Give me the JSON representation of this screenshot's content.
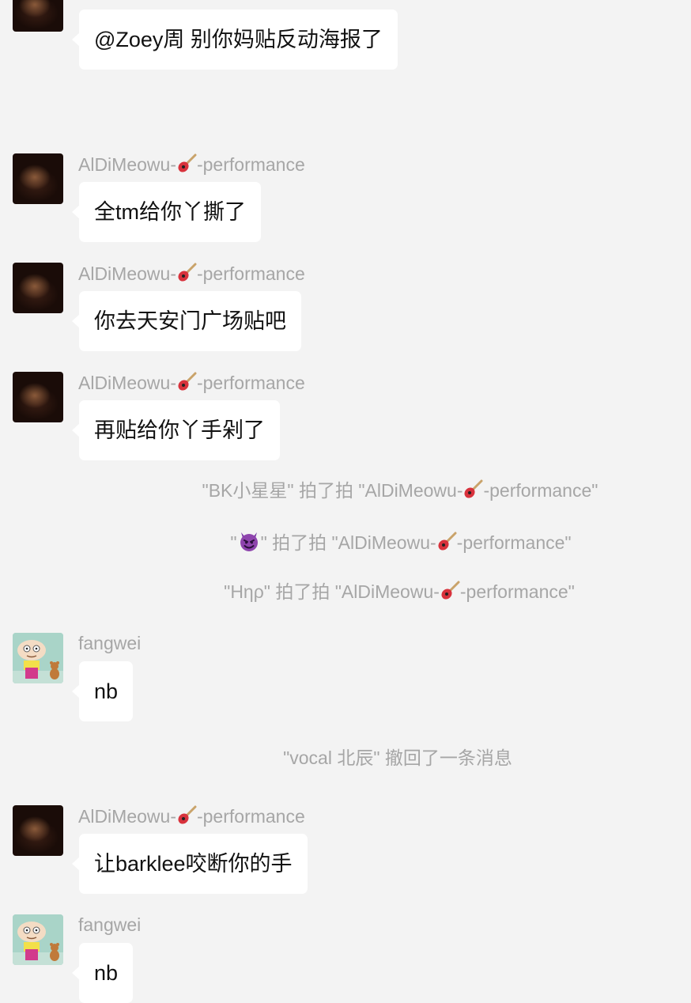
{
  "messages": [
    {
      "sender": "",
      "text": "@Zoey周 别你妈贴反动海报了"
    },
    {
      "sender_prefix": "AlDiMeowu-",
      "sender_suffix": "-performance",
      "sender_icon": "guitar-emoji",
      "text": "全tm给你丫撕了"
    },
    {
      "sender_prefix": "AlDiMeowu-",
      "sender_suffix": "-performance",
      "sender_icon": "guitar-emoji",
      "text": "你去天安门广场贴吧"
    },
    {
      "sender_prefix": "AlDiMeowu-",
      "sender_suffix": "-performance",
      "sender_icon": "guitar-emoji",
      "text": "再贴给你丫手剁了"
    },
    {
      "sender": "fangwei",
      "text": "nb"
    },
    {
      "sender_prefix": "AlDiMeowu-",
      "sender_suffix": "-performance",
      "sender_icon": "guitar-emoji",
      "text": "让barklee咬断你的手"
    },
    {
      "sender": "fangwei",
      "text": "nb"
    }
  ],
  "system_notices": [
    {
      "before": "\"BK小星星\" 拍了拍 \"AlDiMeowu-",
      "after": "-performance\""
    },
    {
      "before_open": "\"",
      "devil_icon": "smiling-devil-emoji",
      "before": "\" 拍了拍 \"AlDiMeowu-",
      "after": "-performance\""
    },
    {
      "before": "\"Hηρ\" 拍了拍 \"AlDiMeowu-",
      "after": "-performance\""
    },
    {
      "text": "\"vocal 北辰\" 撤回了一条消息"
    }
  ],
  "colors": {
    "background": "#f3f3f3",
    "bubble": "#ffffff",
    "meta_text": "#a6a6a6",
    "message_text": "#111111"
  }
}
